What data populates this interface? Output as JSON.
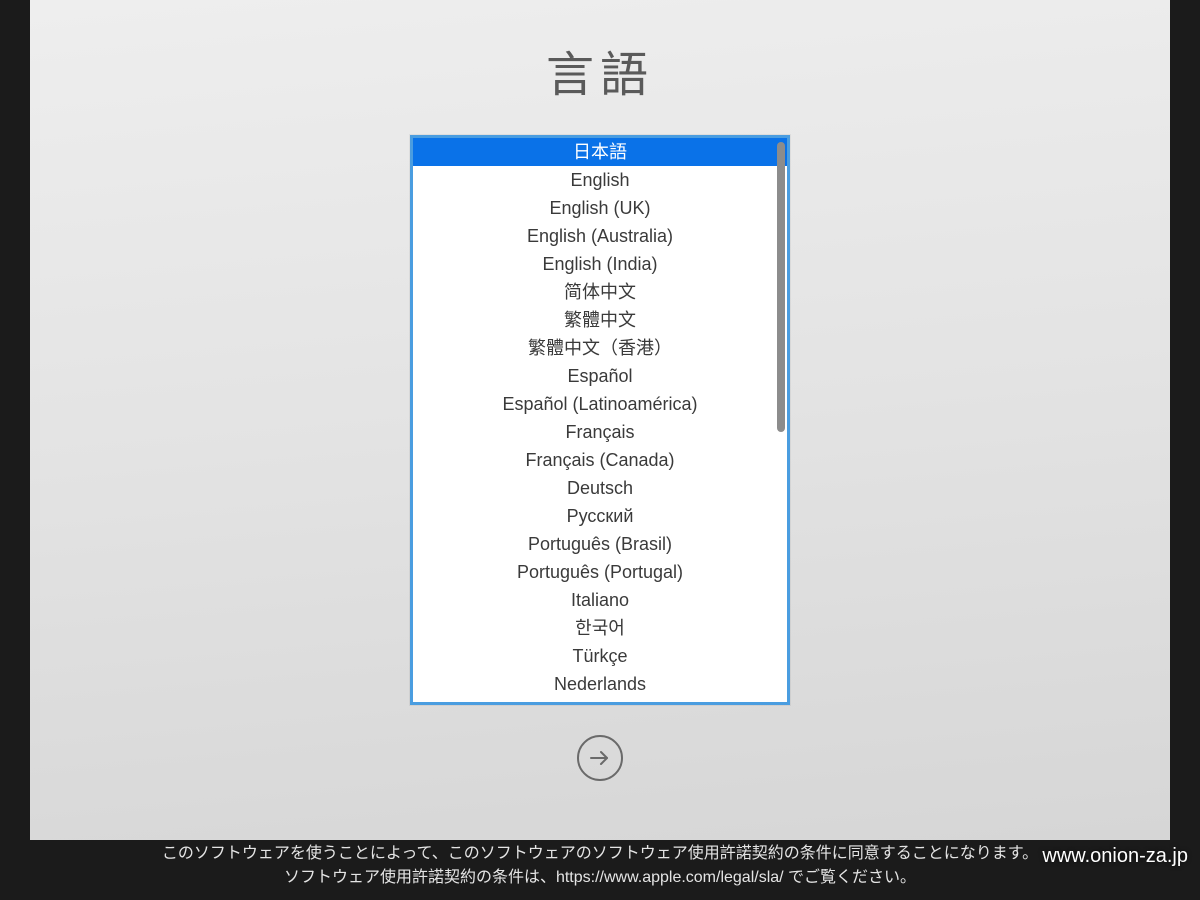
{
  "title": "言語",
  "selected_index": 0,
  "languages": [
    "日本語",
    "English",
    "English (UK)",
    "English (Australia)",
    "English (India)",
    "简体中文",
    "繁體中文",
    "繁體中文（香港）",
    "Español",
    "Español (Latinoamérica)",
    "Français",
    "Français (Canada)",
    "Deutsch",
    "Русский",
    "Português (Brasil)",
    "Português (Portugal)",
    "Italiano",
    "한국어",
    "Türkçe",
    "Nederlands"
  ],
  "legal": {
    "line1": "このソフトウェアを使うことによって、このソフトウェアのソフトウェア使用許諾契約の条件に同意することになります。",
    "line2": "ソフトウェア使用許諾契約の条件は、https://www.apple.com/legal/sla/ でご覧ください。"
  },
  "watermark": "www.onion-za.jp",
  "colors": {
    "selection": "#0a72e8",
    "listbox_border": "#4a9de0"
  }
}
